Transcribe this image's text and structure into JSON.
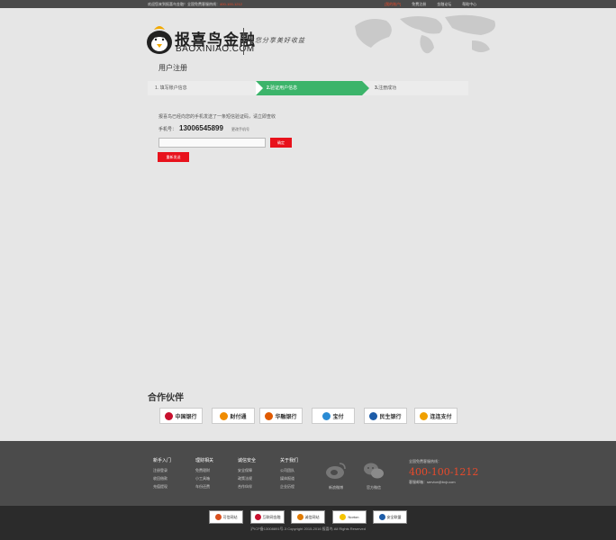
{
  "topbar": {
    "welcome": "欢迎您来到报喜鸟金融！全国免费客服热线：",
    "hotline": "400-100-1212",
    "links": [
      "[我的账户]",
      "免费注册",
      "金融论坛",
      "帮助中心"
    ]
  },
  "header": {
    "logo_cn": "报喜鸟金融",
    "logo_en": "BAOXINIAO.COM",
    "slogan": "与您分享美好收益"
  },
  "page_title": "用户注册",
  "steps": [
    {
      "num": "1.",
      "label": "填写账户信息"
    },
    {
      "num": "2.",
      "label": "验证用户信息"
    },
    {
      "num": "3.",
      "label": "注册成功"
    }
  ],
  "verify": {
    "notice": "报喜鸟已经向您的手机发送了一条短信验证码，请立即查收",
    "phone_label": "手机号：",
    "phone_number": "13006545899",
    "change_link": "更改手机号",
    "code_placeholder": "",
    "confirm_label": "确定",
    "resend_label": "重新发送"
  },
  "partners": {
    "title": "合作伙伴",
    "items": [
      {
        "name": "中国银行",
        "color": "#c8102e"
      },
      {
        "name": "财付通",
        "color": "#f08c00"
      },
      {
        "name": "华融银行",
        "color": "#e05a00"
      },
      {
        "name": "宝付",
        "color": "#2a8bd4"
      },
      {
        "name": "民生银行",
        "color": "#1d5ca8"
      },
      {
        "name": "连连支付",
        "color": "#f0a000"
      }
    ]
  },
  "footer": {
    "columns": [
      {
        "head": "新手入门",
        "items": [
          "注册登录",
          "收回借款",
          "充值提现"
        ]
      },
      {
        "head": "理财相关",
        "items": [
          "免费理财",
          "小工具箱",
          "车份还费"
        ]
      },
      {
        "head": "诚信安全",
        "items": [
          "安全保障",
          "政策法规",
          "合作伙伴"
        ]
      },
      {
        "head": "关于我们",
        "items": [
          "公司团队",
          "媒体报道",
          "企业历程"
        ]
      }
    ],
    "social": [
      {
        "label": "新浪微博",
        "icon": "weibo-icon"
      },
      {
        "label": "官方微信",
        "icon": "wechat-icon"
      }
    ],
    "contact_label": "全国免费客服热线：",
    "contact_tel": "400-100-1212",
    "contact_email": "客服邮箱：service@bxjr.com",
    "badges": [
      {
        "label": "可信网站",
        "color": "#d9501e"
      },
      {
        "label": "互联网金融",
        "color": "#c8102e"
      },
      {
        "label": "诚信网站",
        "color": "#e07a00"
      },
      {
        "label": "Norton",
        "color": "#f5c400"
      },
      {
        "label": "安全联盟",
        "color": "#1d5ca8"
      }
    ],
    "copyright": "沪ICP备13008891号-3   Copyright 2015-2016 报喜鸟 All Rights Reserved"
  }
}
